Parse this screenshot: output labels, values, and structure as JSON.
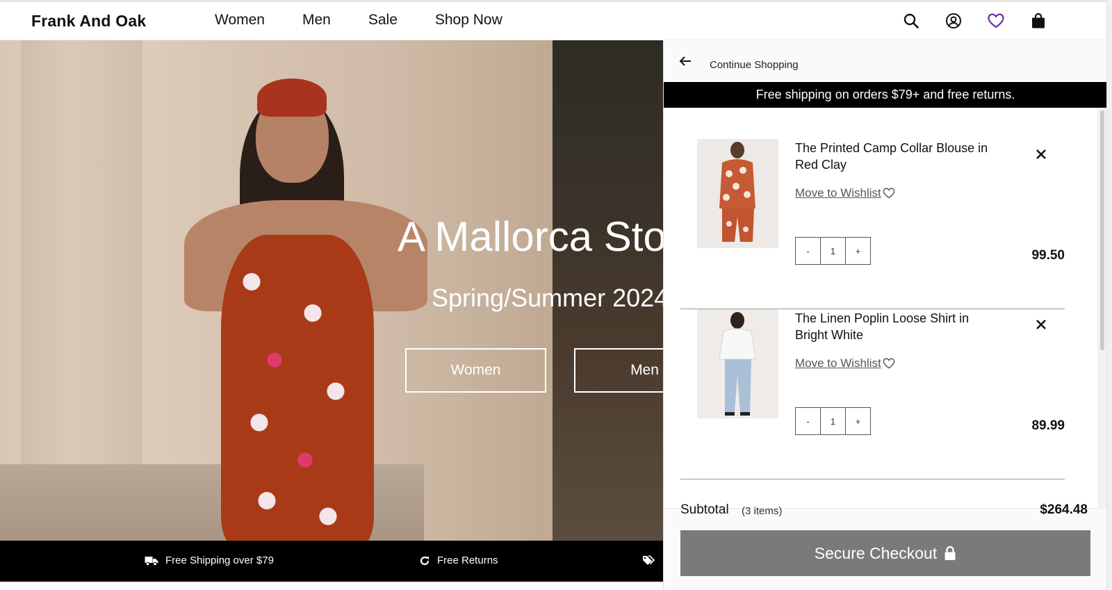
{
  "brand": {
    "logo": "Frank And Oak"
  },
  "nav": {
    "links": [
      "Women",
      "Men",
      "Sale",
      "Shop Now"
    ],
    "icons": [
      "search-icon",
      "account-icon",
      "wishlist-heart-icon",
      "shopping-bag-icon"
    ],
    "wishlist_color": "#6b2fa3"
  },
  "hero": {
    "title": "A Mallorca Sto",
    "subtitle": "Spring/Summer 2024",
    "buttons": [
      "Women",
      "Men"
    ]
  },
  "promo_bar": {
    "items": [
      {
        "icon": "truck-icon",
        "label": "Free Shipping over $79"
      },
      {
        "icon": "refresh-icon",
        "label": "Free Returns"
      },
      {
        "icon": "tags-icon",
        "label": ""
      }
    ]
  },
  "cart": {
    "continue_label": "Continue Shopping",
    "banner": "Free shipping on orders $79+ and free returns.",
    "items": [
      {
        "name": "The Printed Camp Collar Blouse in Red Clay",
        "wishlist_label": "Move to Wishlist ",
        "qty_minus": "-",
        "qty": "1",
        "qty_plus": "+",
        "price": "99.50"
      },
      {
        "name": "The Linen Poplin Loose Shirt in Bright White",
        "wishlist_label": "Move to Wishlist ",
        "qty_minus": "-",
        "qty": "1",
        "qty_plus": "+",
        "price": "89.99"
      }
    ],
    "subtotal_label": "Subtotal",
    "subtotal_count": "(3 items)",
    "subtotal_amount": "$264.48",
    "checkout_label": "Secure Checkout",
    "checkout_color": "#7a7a7a"
  }
}
